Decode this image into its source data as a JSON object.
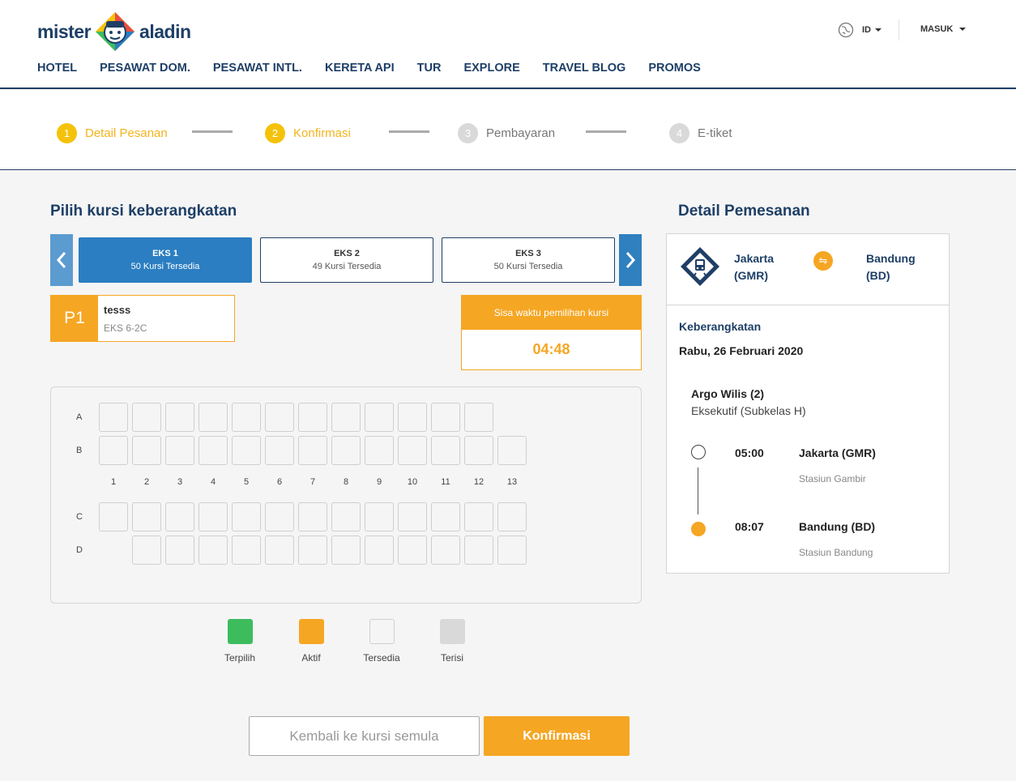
{
  "brand": {
    "left": "mister",
    "right": "aladin"
  },
  "nav": [
    "HOTEL",
    "PESAWAT DOM.",
    "PESAWAT INTL.",
    "KERETA API",
    "TUR",
    "EXPLORE",
    "TRAVEL BLOG",
    "PROMOS"
  ],
  "header": {
    "language": "ID",
    "login": "MASUK"
  },
  "steps": [
    {
      "num": "1",
      "label": "Detail Pesanan",
      "state": "active"
    },
    {
      "num": "2",
      "label": "Konfirmasi",
      "state": "active"
    },
    {
      "num": "3",
      "label": "Pembayaran",
      "state": "inactive"
    },
    {
      "num": "4",
      "label": "E-tiket",
      "state": "inactive"
    }
  ],
  "seat_section": {
    "title": "Pilih kursi keberangkatan",
    "wagons": [
      {
        "name": "EKS 1",
        "available": "50 Kursi Tersedia",
        "active": true
      },
      {
        "name": "EKS 2",
        "available": "49 Kursi Tersedia",
        "active": false
      },
      {
        "name": "EKS 3",
        "available": "50 Kursi Tersedia",
        "active": false
      }
    ],
    "passenger": {
      "badge": "P1",
      "name": "tesss",
      "seat": "EKS 6-2C"
    },
    "timer": {
      "label": "Sisa waktu pemilihan kursi",
      "value": "04:48"
    },
    "rows_top": [
      {
        "label": "A",
        "seats": [
          1,
          2,
          3,
          4,
          5,
          6,
          7,
          8,
          9,
          10,
          11,
          12
        ]
      },
      {
        "label": "B",
        "seats": [
          1,
          2,
          3,
          4,
          5,
          6,
          7,
          8,
          9,
          10,
          11,
          12,
          13
        ]
      }
    ],
    "columns": [
      "1",
      "2",
      "3",
      "4",
      "5",
      "6",
      "7",
      "8",
      "9",
      "10",
      "11",
      "12",
      "13"
    ],
    "rows_bottom": [
      {
        "label": "C",
        "seats": [
          1,
          2,
          3,
          4,
          5,
          6,
          7,
          8,
          9,
          10,
          11,
          12,
          13
        ]
      },
      {
        "label": "D",
        "seats": [
          2,
          3,
          4,
          5,
          6,
          7,
          8,
          9,
          10,
          11,
          12,
          13
        ]
      }
    ],
    "legend": [
      {
        "label": "Terpilih",
        "color": "#3dbc5e",
        "border": "#3dbc5e"
      },
      {
        "label": "Aktif",
        "color": "#f5a623",
        "border": "#f5a623"
      },
      {
        "label": "Tersedia",
        "color": "#f5f5f5",
        "border": "#cfcfcf"
      },
      {
        "label": "Terisi",
        "color": "#d9d9d9",
        "border": "#d9d9d9"
      }
    ],
    "buttons": {
      "reset": "Kembali ke kursi semula",
      "confirm": "Konfirmasi"
    }
  },
  "booking": {
    "title": "Detail Pemesanan",
    "origin": {
      "city": "Jakarta",
      "code": "(GMR)"
    },
    "destination": {
      "city": "Bandung",
      "code": "(BD)"
    },
    "swap_icon": "⇋",
    "departure_label": "Keberangkatan",
    "date": "Rabu, 26 Februari 2020",
    "train": "Argo Wilis (2)",
    "class": "Eksekutif (Subkelas H)",
    "stops": [
      {
        "time": "05:00",
        "station": "Jakarta (GMR)",
        "station_name": "Stasiun Gambir"
      },
      {
        "time": "08:07",
        "station": "Bandung (BD)",
        "station_name": "Stasiun Bandung"
      }
    ]
  },
  "colors": {
    "navy": "#1e3f66",
    "orange": "#f5a623",
    "blue": "#2b7ec1",
    "yellow": "#f5c20b"
  }
}
